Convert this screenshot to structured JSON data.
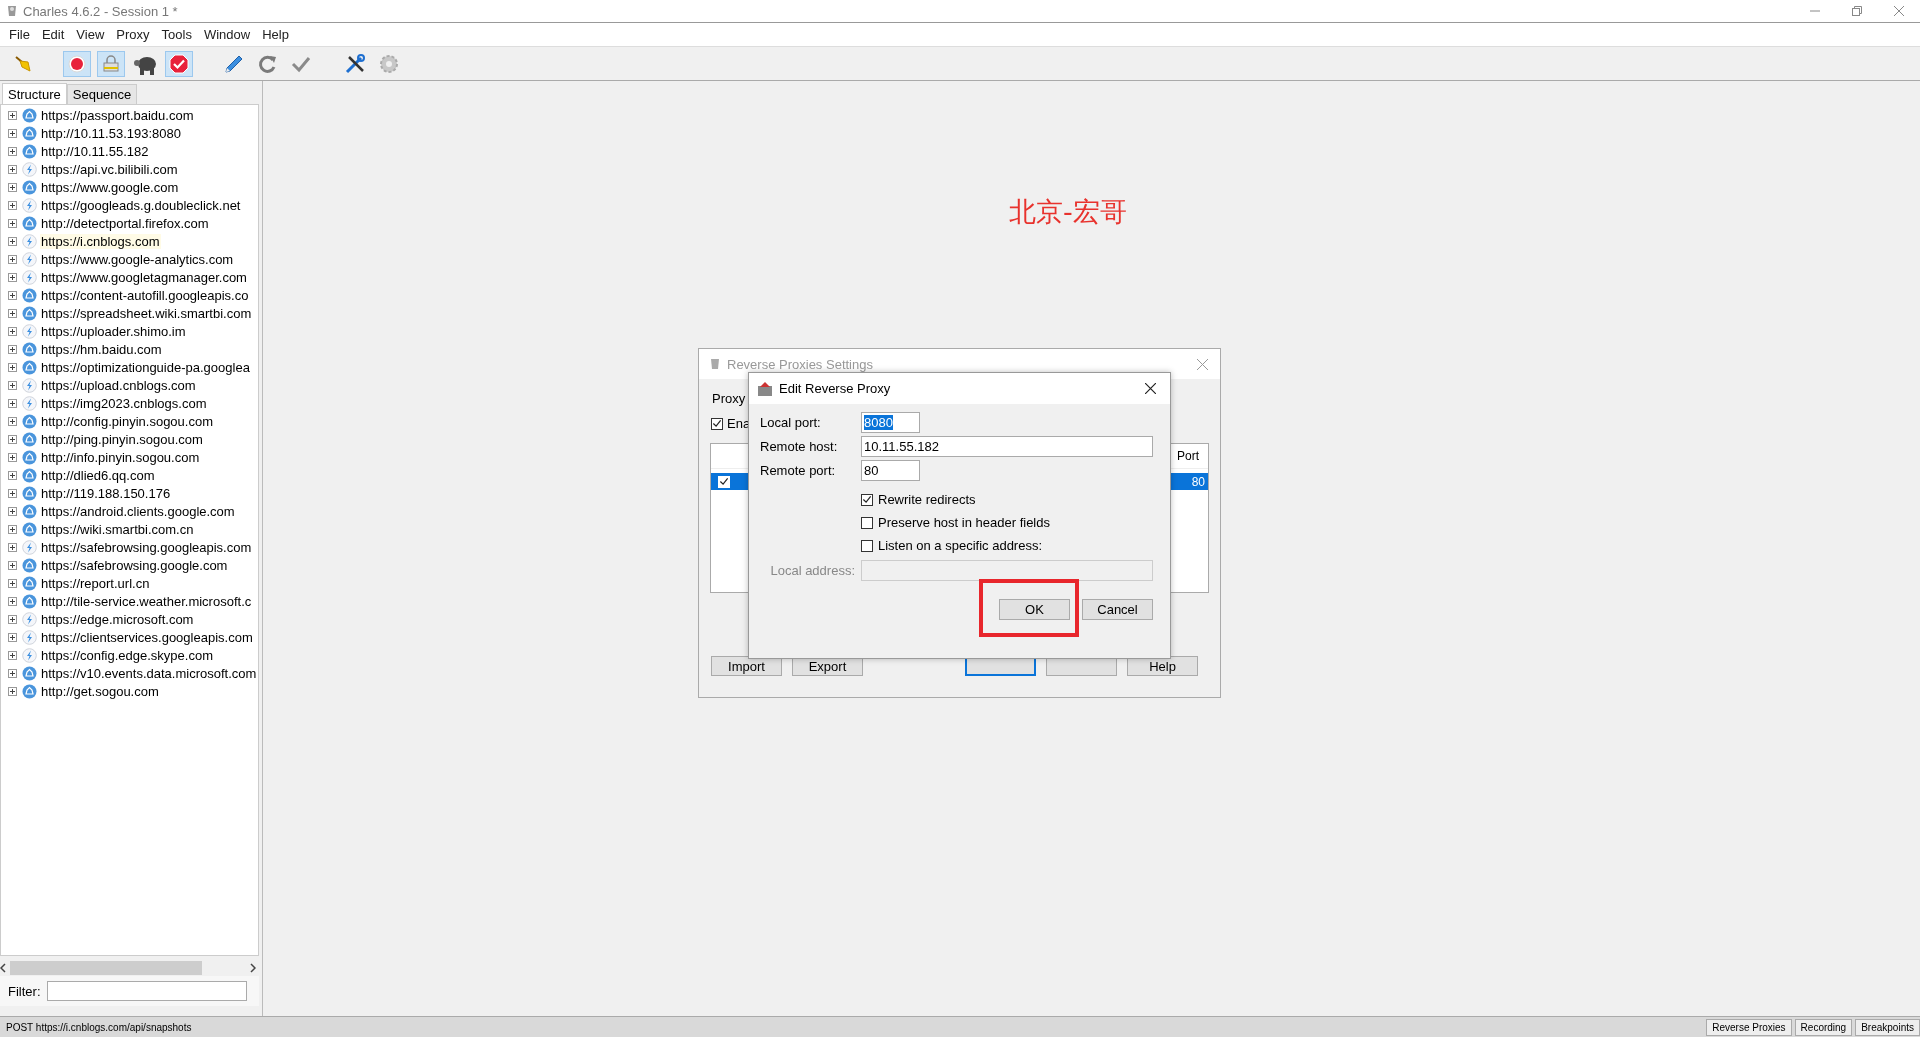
{
  "window": {
    "title": "Charles 4.6.2 - Session 1 *"
  },
  "menu": [
    "File",
    "Edit",
    "View",
    "Proxy",
    "Tools",
    "Window",
    "Help"
  ],
  "toolbar": [
    {
      "kind": "broom",
      "pressed": false
    },
    {
      "kind": "record",
      "pressed": true
    },
    {
      "kind": "throttle",
      "pressed": true
    },
    {
      "kind": "turtle",
      "pressed": false
    },
    {
      "kind": "breakpoints",
      "pressed": true
    },
    {
      "kind": "pen",
      "pressed": false
    },
    {
      "kind": "refresh",
      "pressed": false
    },
    {
      "kind": "check",
      "pressed": false
    },
    {
      "kind": "tools",
      "pressed": false
    },
    {
      "kind": "gear",
      "pressed": false
    }
  ],
  "view_tabs": [
    {
      "label": "Structure",
      "selected": true
    },
    {
      "label": "Sequence",
      "selected": false
    }
  ],
  "hosts": [
    {
      "label": "https://passport.baidu.com",
      "kind": "globe",
      "highlighted": false
    },
    {
      "label": "http://10.11.53.193:8080",
      "kind": "globe",
      "highlighted": false
    },
    {
      "label": "http://10.11.55.182",
      "kind": "globe",
      "highlighted": false
    },
    {
      "label": "https://api.vc.bilibili.com",
      "kind": "bolt",
      "highlighted": false
    },
    {
      "label": "https://www.google.com",
      "kind": "globe",
      "highlighted": false
    },
    {
      "label": "https://googleads.g.doubleclick.net",
      "kind": "bolt",
      "highlighted": false
    },
    {
      "label": "http://detectportal.firefox.com",
      "kind": "globe",
      "highlighted": false
    },
    {
      "label": "https://i.cnblogs.com",
      "kind": "bolt",
      "highlighted": true
    },
    {
      "label": "https://www.google-analytics.com",
      "kind": "bolt",
      "highlighted": false
    },
    {
      "label": "https://www.googletagmanager.com",
      "kind": "bolt",
      "highlighted": false
    },
    {
      "label": "https://content-autofill.googleapis.co",
      "kind": "globe",
      "highlighted": false
    },
    {
      "label": "https://spreadsheet.wiki.smartbi.com",
      "kind": "globe",
      "highlighted": false
    },
    {
      "label": "https://uploader.shimo.im",
      "kind": "bolt",
      "highlighted": false
    },
    {
      "label": "https://hm.baidu.com",
      "kind": "globe",
      "highlighted": false
    },
    {
      "label": "https://optimizationguide-pa.googlea",
      "kind": "globe",
      "highlighted": false
    },
    {
      "label": "https://upload.cnblogs.com",
      "kind": "bolt",
      "highlighted": false
    },
    {
      "label": "https://img2023.cnblogs.com",
      "kind": "bolt",
      "highlighted": false
    },
    {
      "label": "http://config.pinyin.sogou.com",
      "kind": "globe",
      "highlighted": false
    },
    {
      "label": "http://ping.pinyin.sogou.com",
      "kind": "globe",
      "highlighted": false
    },
    {
      "label": "http://info.pinyin.sogou.com",
      "kind": "globe",
      "highlighted": false
    },
    {
      "label": "http://dlied6.qq.com",
      "kind": "globe",
      "highlighted": false
    },
    {
      "label": "http://119.188.150.176",
      "kind": "globe",
      "highlighted": false
    },
    {
      "label": "https://android.clients.google.com",
      "kind": "globe",
      "highlighted": false
    },
    {
      "label": "https://wiki.smartbi.com.cn",
      "kind": "globe",
      "highlighted": false
    },
    {
      "label": "https://safebrowsing.googleapis.com",
      "kind": "bolt",
      "highlighted": false
    },
    {
      "label": "https://safebrowsing.google.com",
      "kind": "globe",
      "highlighted": false
    },
    {
      "label": "https://report.url.cn",
      "kind": "globe",
      "highlighted": false
    },
    {
      "label": "http://tile-service.weather.microsoft.c",
      "kind": "globe",
      "highlighted": false
    },
    {
      "label": "https://edge.microsoft.com",
      "kind": "bolt",
      "highlighted": false
    },
    {
      "label": "https://clientservices.googleapis.com",
      "kind": "bolt",
      "highlighted": false
    },
    {
      "label": "https://config.edge.skype.com",
      "kind": "bolt",
      "highlighted": false
    },
    {
      "label": "https://v10.events.data.microsoft.com",
      "kind": "globe",
      "highlighted": false
    },
    {
      "label": "http://get.sogou.com",
      "kind": "globe",
      "highlighted": false
    }
  ],
  "filter": {
    "label": "Filter:"
  },
  "annotation": "北京-宏哥",
  "settings_dialog": {
    "title": "Reverse Proxies Settings",
    "section": "Proxy",
    "enable": {
      "label": "Ena",
      "checked": true
    },
    "table": {
      "header": "Port",
      "rows": [
        {
          "checked": true,
          "selected": true,
          "port": "80"
        }
      ]
    },
    "buttons": [
      {
        "label": "Import",
        "kind": "text"
      },
      {
        "label": "Export",
        "kind": "text"
      },
      {
        "kind": "hidden",
        "focused": true
      },
      {
        "kind": "hidden",
        "focused": false
      },
      {
        "label": "Help",
        "kind": "text"
      }
    ]
  },
  "edit_dialog": {
    "title": "Edit Reverse Proxy",
    "fields": [
      {
        "label": "Local port:",
        "value": "8080",
        "kind": "port",
        "text_selected": true,
        "disabled": false
      },
      {
        "label": "Remote host:",
        "value": "10.11.55.182",
        "kind": "host",
        "text_selected": false,
        "disabled": false
      },
      {
        "label": "Remote port:",
        "value": "80",
        "kind": "port",
        "text_selected": false,
        "disabled": false
      }
    ],
    "options": [
      {
        "label": "Rewrite redirects",
        "checked": true
      },
      {
        "label": "Preserve host in header fields",
        "checked": false
      },
      {
        "label": "Listen on a specific address:",
        "checked": false
      }
    ],
    "address_field": {
      "label": "Local address:",
      "kind": "host",
      "disabled": true
    },
    "buttons": [
      {
        "label": "OK",
        "highlighted": true
      },
      {
        "label": "Cancel",
        "highlighted": false
      }
    ]
  },
  "status_bar": {
    "text": "POST https://i.cnblogs.com/api/snapshots",
    "buttons": [
      "Reverse Proxies",
      "Recording",
      "Breakpoints"
    ]
  }
}
